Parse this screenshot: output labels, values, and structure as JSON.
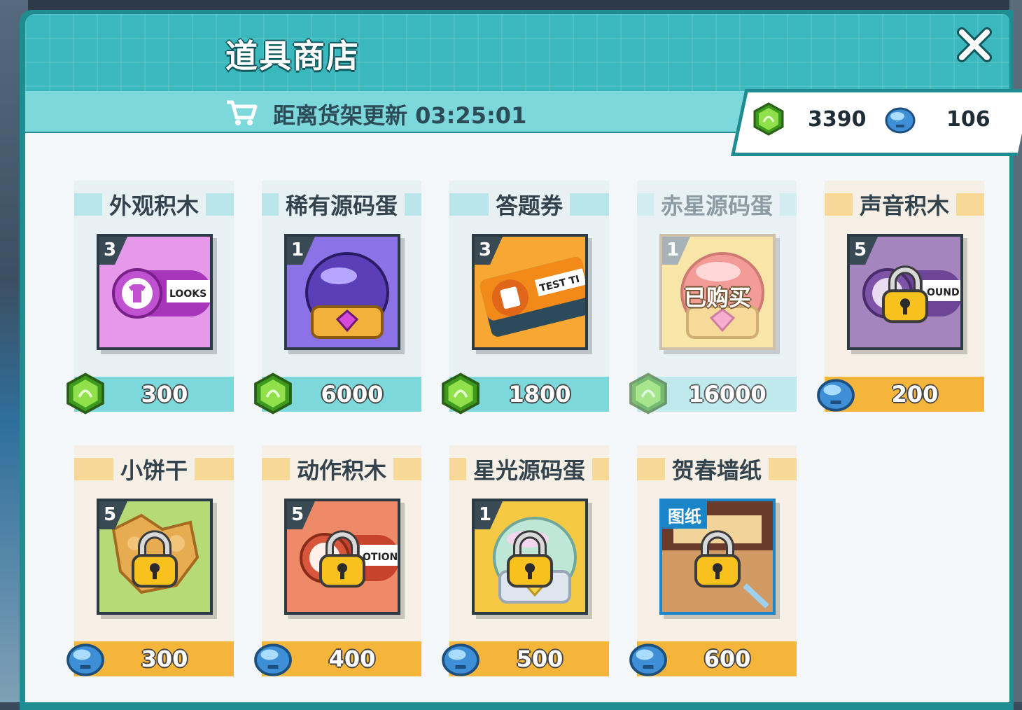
{
  "shop": {
    "title": "道具商店",
    "refresh_label": "距离货架更新 03:25:01"
  },
  "currency": {
    "gems": "3390",
    "bells": "106"
  },
  "items": [
    {
      "name": "外观积木",
      "count": "3",
      "price": "300",
      "currency": "gem",
      "state": "available"
    },
    {
      "name": "稀有源码蛋",
      "count": "1",
      "price": "6000",
      "currency": "gem",
      "state": "available"
    },
    {
      "name": "答题券",
      "count": "3",
      "price": "1800",
      "currency": "gem",
      "state": "available"
    },
    {
      "name": "赤星源码蛋",
      "count": "1",
      "price": "16000",
      "currency": "gem",
      "state": "bought",
      "status": "已购买"
    },
    {
      "name": "声音积木",
      "count": "5",
      "price": "200",
      "currency": "bell",
      "state": "locked"
    },
    {
      "name": "小饼干",
      "count": "5",
      "price": "300",
      "currency": "bell",
      "state": "locked"
    },
    {
      "name": "动作积木",
      "count": "5",
      "price": "400",
      "currency": "bell",
      "state": "locked"
    },
    {
      "name": "星光源码蛋",
      "count": "1",
      "price": "500",
      "currency": "bell",
      "state": "locked"
    },
    {
      "name": "贺春墙纸",
      "tag": "图纸",
      "price": "600",
      "currency": "bell",
      "state": "locked"
    }
  ],
  "item_art_text": {
    "looks": "LOOKS",
    "test": "TEST TI",
    "sound": "OUND",
    "motion": "OTION"
  },
  "colors": {
    "teal": "#3ab8be",
    "dark_teal": "#1f8c92",
    "light_teal_bar": "#7dd8dc",
    "orange_bar": "#f5b43a",
    "gem_green": "#5cc23a",
    "bell_blue": "#5ab4ec"
  }
}
